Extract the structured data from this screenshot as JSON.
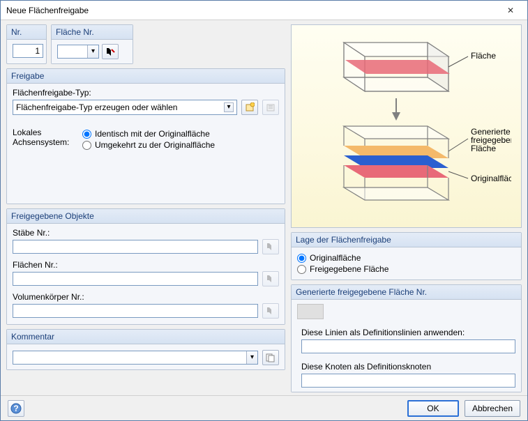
{
  "window": {
    "title": "Neue Flächenfreigabe"
  },
  "top": {
    "nr_hd": "Nr.",
    "nr_value": "1",
    "flaeche_hd": "Fläche Nr.",
    "flaeche_value": ""
  },
  "freigabe": {
    "hd": "Freigabe",
    "typ_label": "Flächenfreigabe-Typ:",
    "typ_placeholder": "Flächenfreigabe-Typ erzeugen oder wählen",
    "axis_label1": "Lokales",
    "axis_label2": "Achsensystem:",
    "radio_identisch": "Identisch mit der Originalfläche",
    "radio_umgekehrt": "Umgekehrt zu der Originalfläche"
  },
  "objekte": {
    "hd": "Freigegebene Objekte",
    "staebe_label": "Stäbe Nr.:",
    "flaechen_label": "Flächen Nr.:",
    "vol_label": "Volumenkörper Nr.:"
  },
  "kommentar": {
    "hd": "Kommentar"
  },
  "illus": {
    "label_flaeche": "Fläche",
    "label_gen1": "Generierte",
    "label_gen2": "freigegebene",
    "label_gen3": "Fläche",
    "label_orig": "Originalfläche"
  },
  "lage": {
    "hd": "Lage der Flächenfreigabe",
    "radio_orig": "Originalfläche",
    "radio_frei": "Freigegebene Fläche"
  },
  "gen": {
    "hd": "Generierte freigegebene Fläche Nr.",
    "def_lines": "Diese Linien als Definitionslinien anwenden:",
    "def_nodes": "Diese Knoten als Definitionsknoten"
  },
  "buttons": {
    "ok": "OK",
    "cancel": "Abbrechen"
  }
}
